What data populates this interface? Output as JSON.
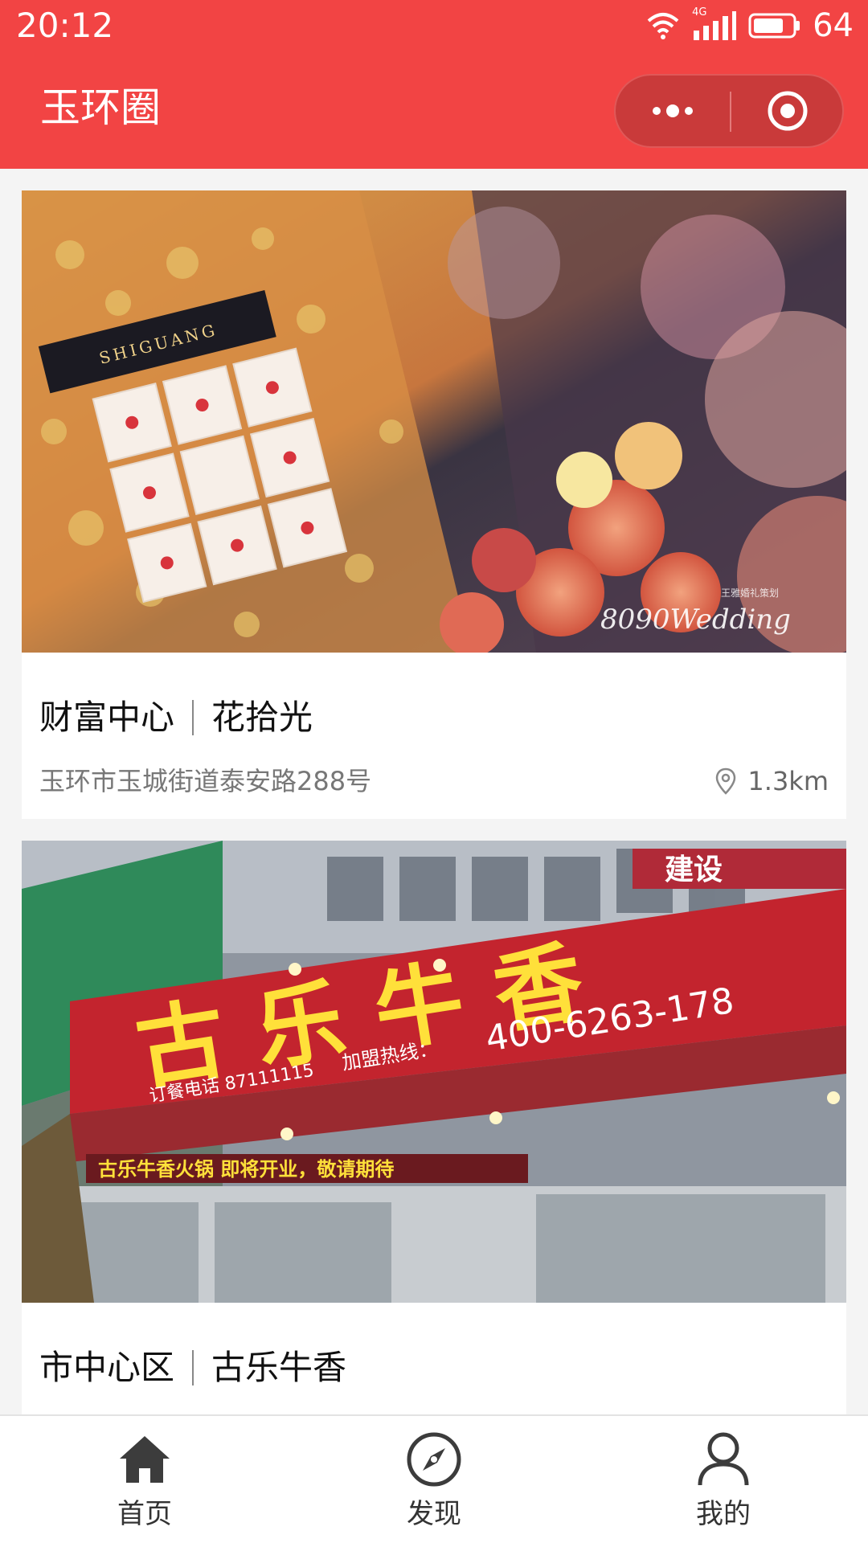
{
  "status_bar": {
    "time": "20:12",
    "network": "4G",
    "battery": "64"
  },
  "header": {
    "title": "玉环圈"
  },
  "feed": {
    "cards": [
      {
        "district": "财富中心",
        "name": "花拾光",
        "address": "玉环市玉城街道泰安路288号",
        "distance": "1.3km",
        "photo_texts": [
          "SHIGUANG",
          "8090Wedding",
          "王雅婚礼策划"
        ]
      },
      {
        "district": "市中心区",
        "name": "古乐牛香",
        "photo_texts": [
          "古乐牛香",
          "加盟热线：",
          "400-6263-178",
          "订餐电话 87111115",
          "古乐牛香火锅 即将开业，敬请期待",
          "建设"
        ]
      }
    ]
  },
  "tabbar": {
    "tabs": [
      {
        "label": "首页",
        "icon": "home-icon",
        "active": true
      },
      {
        "label": "发现",
        "icon": "compass-icon",
        "active": false
      },
      {
        "label": "我的",
        "icon": "user-icon",
        "active": false
      }
    ]
  },
  "colors": {
    "brand_red": "#f24444",
    "capsule": "#c93a3a"
  }
}
